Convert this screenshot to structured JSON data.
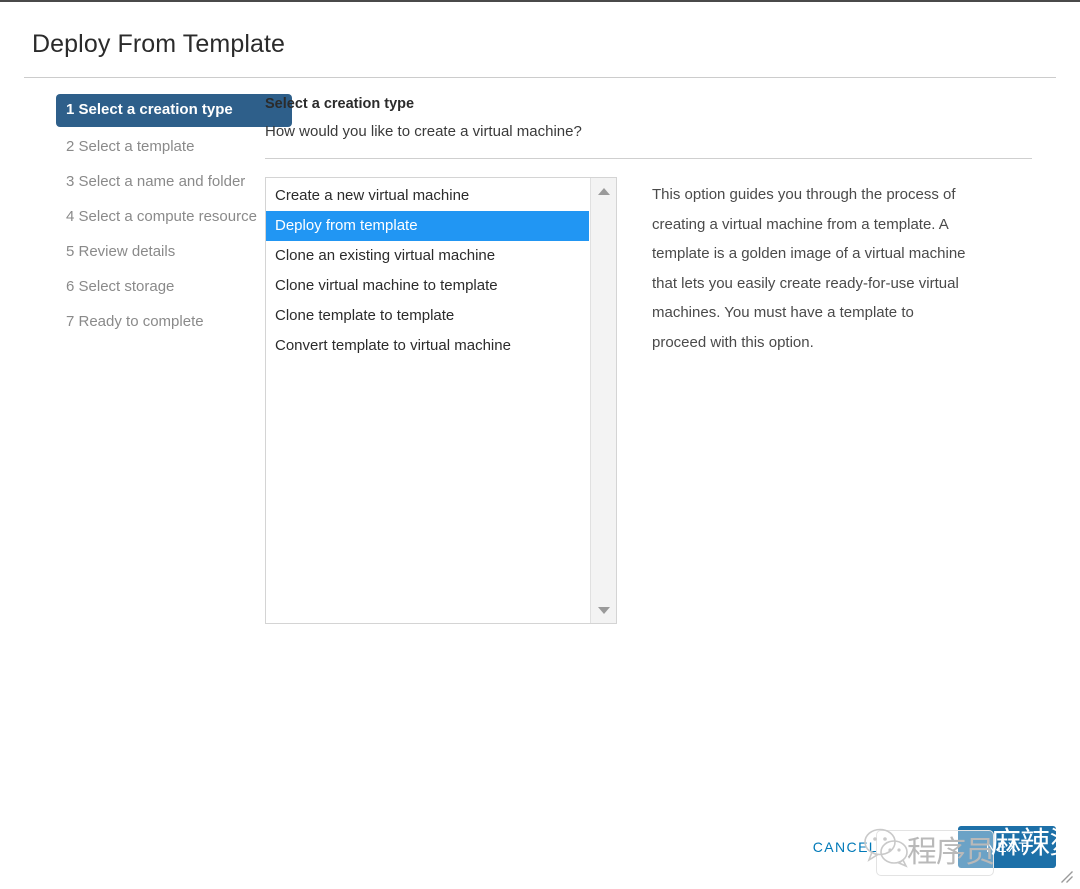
{
  "dialog": {
    "title": "Deploy From Template"
  },
  "steps": [
    {
      "num": "1",
      "label": "Select a creation type",
      "active": true
    },
    {
      "num": "2",
      "label": "Select a template",
      "active": false
    },
    {
      "num": "3",
      "label": "Select a name and folder",
      "active": false
    },
    {
      "num": "4",
      "label": "Select a compute resource",
      "active": false
    },
    {
      "num": "5",
      "label": "Review details",
      "active": false
    },
    {
      "num": "6",
      "label": "Select storage",
      "active": false
    },
    {
      "num": "7",
      "label": "Ready to complete",
      "active": false
    }
  ],
  "main": {
    "heading": "Select a creation type",
    "subheading": "How would you like to create a virtual machine?"
  },
  "listbox": {
    "options": [
      {
        "label": "Create a new virtual machine",
        "selected": false
      },
      {
        "label": "Deploy from template",
        "selected": true
      },
      {
        "label": "Clone an existing virtual machine",
        "selected": false
      },
      {
        "label": "Clone virtual machine to template",
        "selected": false
      },
      {
        "label": "Clone template to template",
        "selected": false
      },
      {
        "label": "Convert template to virtual machine",
        "selected": false
      }
    ],
    "scroll_up_icon": "triangle-up-icon",
    "scroll_down_icon": "triangle-down-icon"
  },
  "description": {
    "text": "This option guides you through the process of creating a virtual machine from a template. A template is a golden image of a virtual machine that lets you easily create ready-for-use virtual machines. You must have a template to proceed with this option."
  },
  "footer": {
    "cancel_label": "CANCEL",
    "next_label": "NEXT"
  },
  "watermark": {
    "logo_icon": "wechat-icon",
    "text": "程序员",
    "overlay_text": "麻辣烫"
  },
  "colors": {
    "active_step_bg": "#2e5f8a",
    "selection_bg": "#2196f3",
    "cancel_text": "#0079b8",
    "next_bg": "#1d70a8"
  }
}
